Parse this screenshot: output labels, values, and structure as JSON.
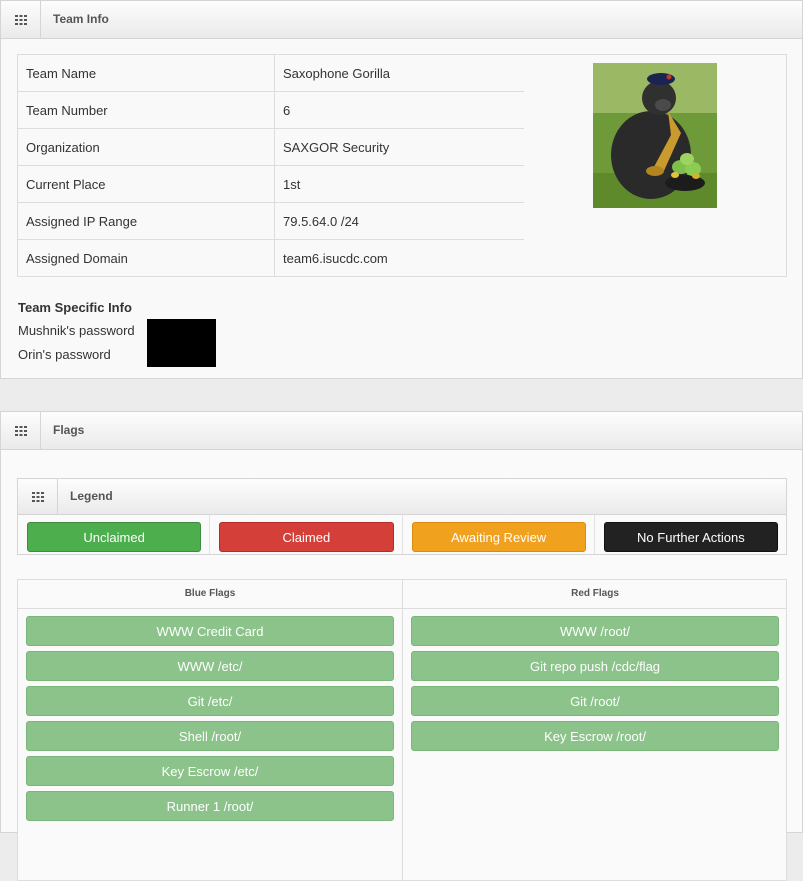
{
  "team_info_panel": {
    "title": "Team Info",
    "rows": [
      {
        "label": "Team Name",
        "value": "Saxophone Gorilla"
      },
      {
        "label": "Team Number",
        "value": "6"
      },
      {
        "label": "Organization",
        "value": "SAXGOR Security"
      },
      {
        "label": "Current Place",
        "value": "1st"
      },
      {
        "label": "Assigned IP Range",
        "value": "79.5.64.0 /24"
      },
      {
        "label": "Assigned Domain",
        "value": "team6.isucdc.com"
      }
    ],
    "specific": {
      "title": "Team Specific Info",
      "mushnik_label": "Mushnik's password",
      "orin_label": "Orin's password"
    }
  },
  "flags_panel": {
    "title": "Flags",
    "legend": {
      "title": "Legend",
      "items": [
        {
          "label": "Unclaimed",
          "color": "#4cae4c"
        },
        {
          "label": "Claimed",
          "color": "#d43f3a"
        },
        {
          "label": "Awaiting Review",
          "color": "#f0a21e"
        },
        {
          "label": "No Further Actions",
          "color": "#222222"
        }
      ]
    },
    "blue_flags": {
      "title": "Blue Flags",
      "items": [
        "WWW Credit Card",
        "WWW /etc/",
        "Git /etc/",
        "Shell /root/",
        "Key Escrow /etc/",
        "Runner 1 /root/"
      ]
    },
    "red_flags": {
      "title": "Red Flags",
      "items": [
        "WWW /root/",
        "Git repo push /cdc/flag",
        "Git /root/",
        "Key Escrow /root/"
      ]
    }
  }
}
